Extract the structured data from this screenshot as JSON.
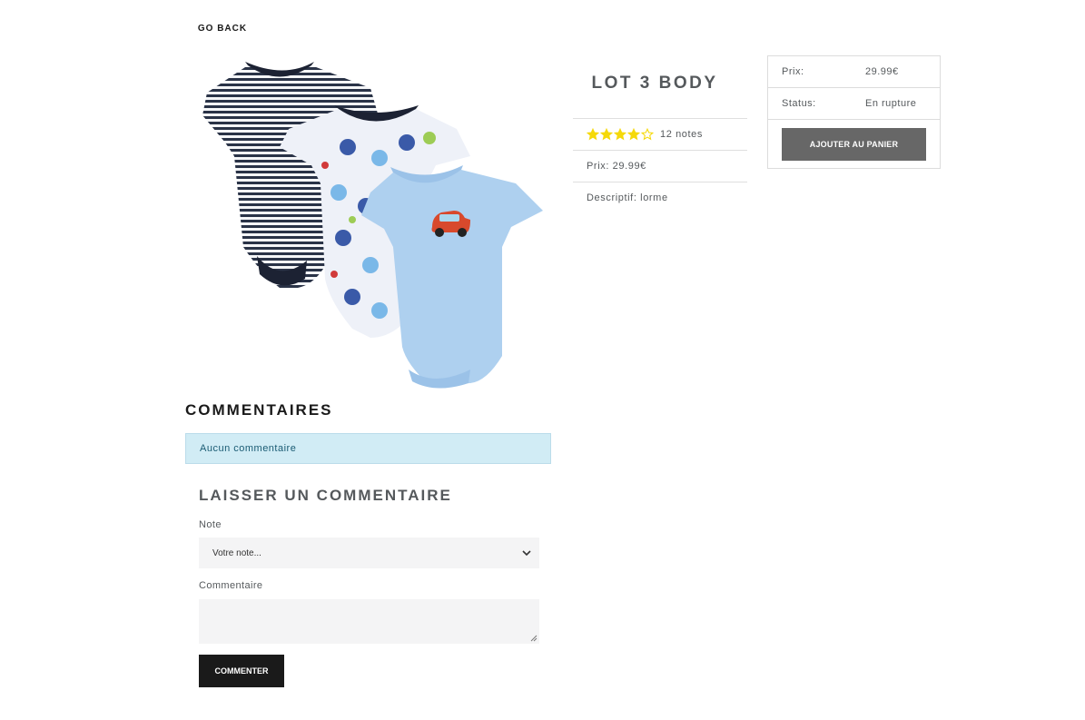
{
  "nav": {
    "go_back": "GO BACK"
  },
  "product": {
    "title": "LOT 3 BODY",
    "rating": {
      "value": 4,
      "max": 5,
      "count_text": "12 notes"
    },
    "price_text": "Prix: 29.99€",
    "description_text": "Descriptif: lorme",
    "image_alt": "three baby bodysuits"
  },
  "purchase_card": {
    "price_label": "Prix:",
    "price_value": "29.99€",
    "status_label": "Status:",
    "status_value": "En rupture",
    "add_to_cart": "AJOUTER AU PANIER"
  },
  "comments": {
    "heading": "COMMENTAIRES",
    "empty_message": "Aucun commentaire"
  },
  "form": {
    "heading": "LAISSER UN COMMENTAIRE",
    "note_label": "Note",
    "note_selected": "Votre note...",
    "comment_label": "Commentaire",
    "comment_value": "",
    "submit": "COMMENTER"
  },
  "colors": {
    "star": "#f5d90a",
    "alert_bg": "#d1ecf5",
    "add_cart_bg": "#676767",
    "submit_bg": "#1a1a1a"
  }
}
